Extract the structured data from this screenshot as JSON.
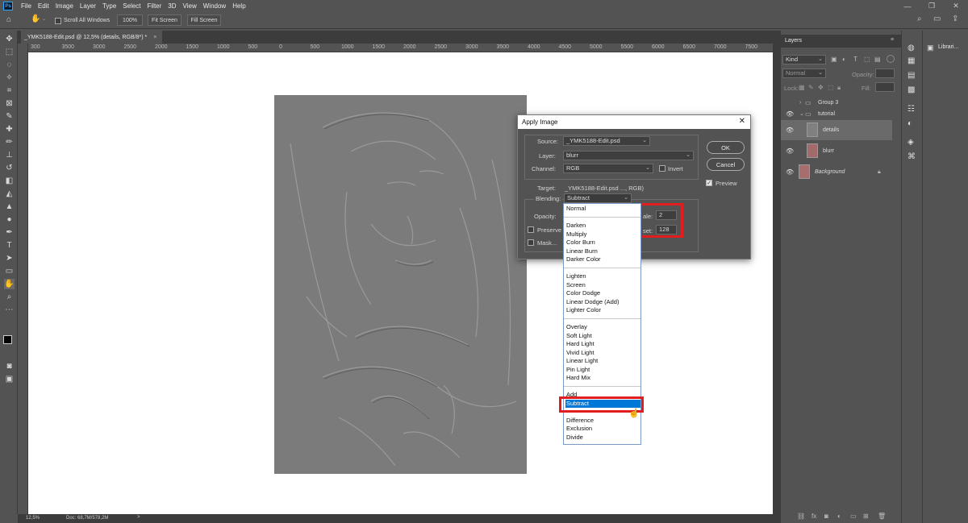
{
  "menu": {
    "items": [
      "File",
      "Edit",
      "Image",
      "Layer",
      "Type",
      "Select",
      "Filter",
      "3D",
      "View",
      "Window",
      "Help"
    ]
  },
  "options": {
    "scroll_all_windows": "Scroll All Windows",
    "zoom_100": "100%",
    "fit_screen": "Fit Screen",
    "fill_screen": "Fill Screen"
  },
  "document": {
    "tab_title": "_YMK5188-Edit.psd @ 12,5% (details, RGB/8*) *",
    "tab_close": "×"
  },
  "ruler": {
    "labels": [
      "300",
      "3500",
      "3000",
      "2500",
      "2000",
      "1500",
      "1000",
      "500",
      "0",
      "500",
      "1000",
      "1500",
      "2000",
      "2500",
      "3000",
      "3500",
      "4000",
      "4500",
      "5000",
      "5500",
      "6000",
      "6500",
      "7000",
      "7500"
    ]
  },
  "status": {
    "zoom": "12,5%",
    "doc": "Doc: 68,7M/578,2M",
    "arrow": ">"
  },
  "layers_panel": {
    "title": "Layers",
    "kind_placeholder": "Kind",
    "blend_mode": "Normal",
    "opacity_label": "Opacity:",
    "lock_label": "Lock:",
    "fill_label": "Fill:",
    "layers": [
      {
        "name": "Group 3",
        "type": "group",
        "visible": false
      },
      {
        "name": "tutorial",
        "type": "group",
        "visible": true
      },
      {
        "name": "details",
        "type": "layer",
        "visible": true,
        "selected": true
      },
      {
        "name": "blurr",
        "type": "layer",
        "visible": true
      },
      {
        "name": "Background",
        "type": "layer",
        "visible": true,
        "locked": true
      }
    ]
  },
  "libraries": {
    "label": "Librari..."
  },
  "dialog": {
    "title": "Apply Image",
    "close": "✕",
    "source_label": "Source:",
    "source_value": "_YMK5188-Edit.psd",
    "layer_label": "Layer:",
    "layer_value": "blurr",
    "channel_label": "Channel:",
    "channel_value": "RGB",
    "invert_label": "Invert",
    "target_label": "Target:",
    "target_value": "_YMK5188-Edit.psd ..., RGB)",
    "blending_label": "Blending:",
    "blending_value": "Subtract",
    "opacity_label": "Opacity:",
    "preserve_label": "Preserve",
    "mask_label": "Mask...",
    "scale_label": "ale:",
    "scale_value": "2",
    "offset_label": "set:",
    "offset_value": "128",
    "ok": "OK",
    "cancel": "Cancel",
    "preview_label": "Preview",
    "preview_checked": true
  },
  "blend_dropdown": {
    "groups": [
      [
        "Normal"
      ],
      [
        "Darken",
        "Multiply",
        "Color Burn",
        "Linear Burn",
        "Darker Color"
      ],
      [
        "Lighten",
        "Screen",
        "Color Dodge",
        "Linear Dodge (Add)",
        "Lighter Color"
      ],
      [
        "Overlay",
        "Soft Light",
        "Hard Light",
        "Vivid Light",
        "Linear Light",
        "Pin Light",
        "Hard Mix"
      ],
      [
        "Add",
        "Subtract"
      ],
      [
        "Difference",
        "Exclusion",
        "Divide"
      ]
    ],
    "selected": "Subtract"
  },
  "colors": {
    "highlight": "#0078d7",
    "annotation": "#e21d1d",
    "ps_bg": "#535353",
    "dark_bg": "#3c3c3c"
  }
}
